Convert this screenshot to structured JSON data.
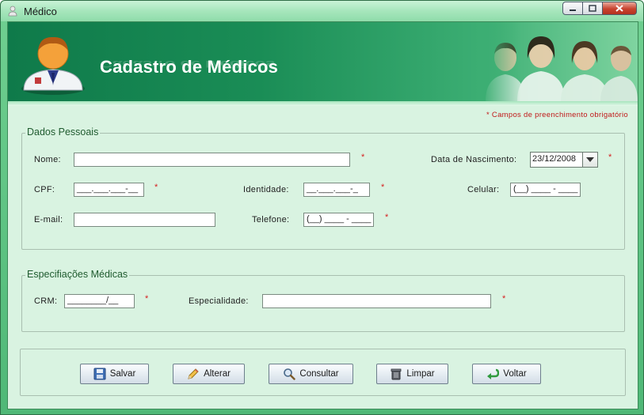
{
  "window": {
    "title": "Médico",
    "icon": "user-icon",
    "buttons": {
      "minimize": "minimize-icon",
      "maximize": "maximize-icon",
      "close": "close-icon"
    }
  },
  "header": {
    "title": "Cadastro de Médicos",
    "logo": "doctor-avatar-icon",
    "photo": "doctors-group-photo"
  },
  "required_note": "* Campos de preenchimento obrigatório",
  "dados_pessoais": {
    "legend": "Dados Pessoais",
    "nome_label": "Nome:",
    "nome_value": "",
    "nascimento_label": "Data de Nascimento:",
    "nascimento_value": "23/12/2008",
    "cpf_label": "CPF:",
    "cpf_value": "___.___.___-__",
    "identidade_label": "Identidade:",
    "identidade_value": "__.___.___-_",
    "celular_label": "Celular:",
    "celular_value": "(__) ____ - ____",
    "email_label": "E-mail:",
    "email_value": "",
    "telefone_label": "Telefone:",
    "telefone_value": "(__) ____ - ____",
    "required_mark": "*"
  },
  "especificacoes": {
    "legend": "Especifiações Médicas",
    "crm_label": "CRM:",
    "crm_value": "________/__",
    "especialidade_label": "Especialidade:",
    "especialidade_value": "",
    "required_mark": "*"
  },
  "actions": {
    "salvar": "Salvar",
    "alterar": "Alterar",
    "consultar": "Consultar",
    "limpar": "Limpar",
    "voltar": "Voltar"
  },
  "colors": {
    "accent": "#1a8d56",
    "required": "#d62020",
    "panel": "#d9f3e1"
  }
}
